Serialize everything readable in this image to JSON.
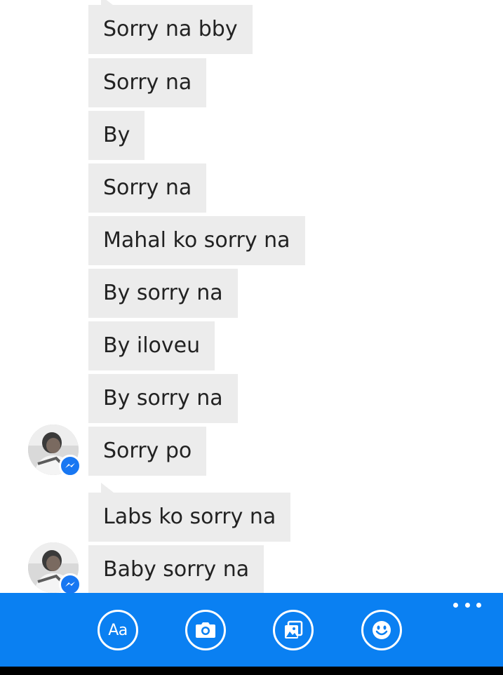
{
  "messages": [
    {
      "text": "Sorry na bby"
    },
    {
      "text": "Sorry na"
    },
    {
      "text": "By"
    },
    {
      "text": "Sorry na"
    },
    {
      "text": "Mahal ko sorry na"
    },
    {
      "text": "By sorry na"
    },
    {
      "text": "By iloveu"
    },
    {
      "text": "By sorry na"
    },
    {
      "text": "Sorry po"
    },
    {
      "text": "Labs ko sorry na"
    },
    {
      "text": "Baby sorry na"
    }
  ],
  "toolbar": {
    "text_button_label": "Aa",
    "icons": [
      "text-format-icon",
      "camera-icon",
      "gallery-icon",
      "emoji-icon",
      "more-dots-icon"
    ]
  },
  "colors": {
    "toolbar_blue": "#0a80f2",
    "bubble_gray": "#ececec",
    "messenger_badge": "#1877f2"
  }
}
